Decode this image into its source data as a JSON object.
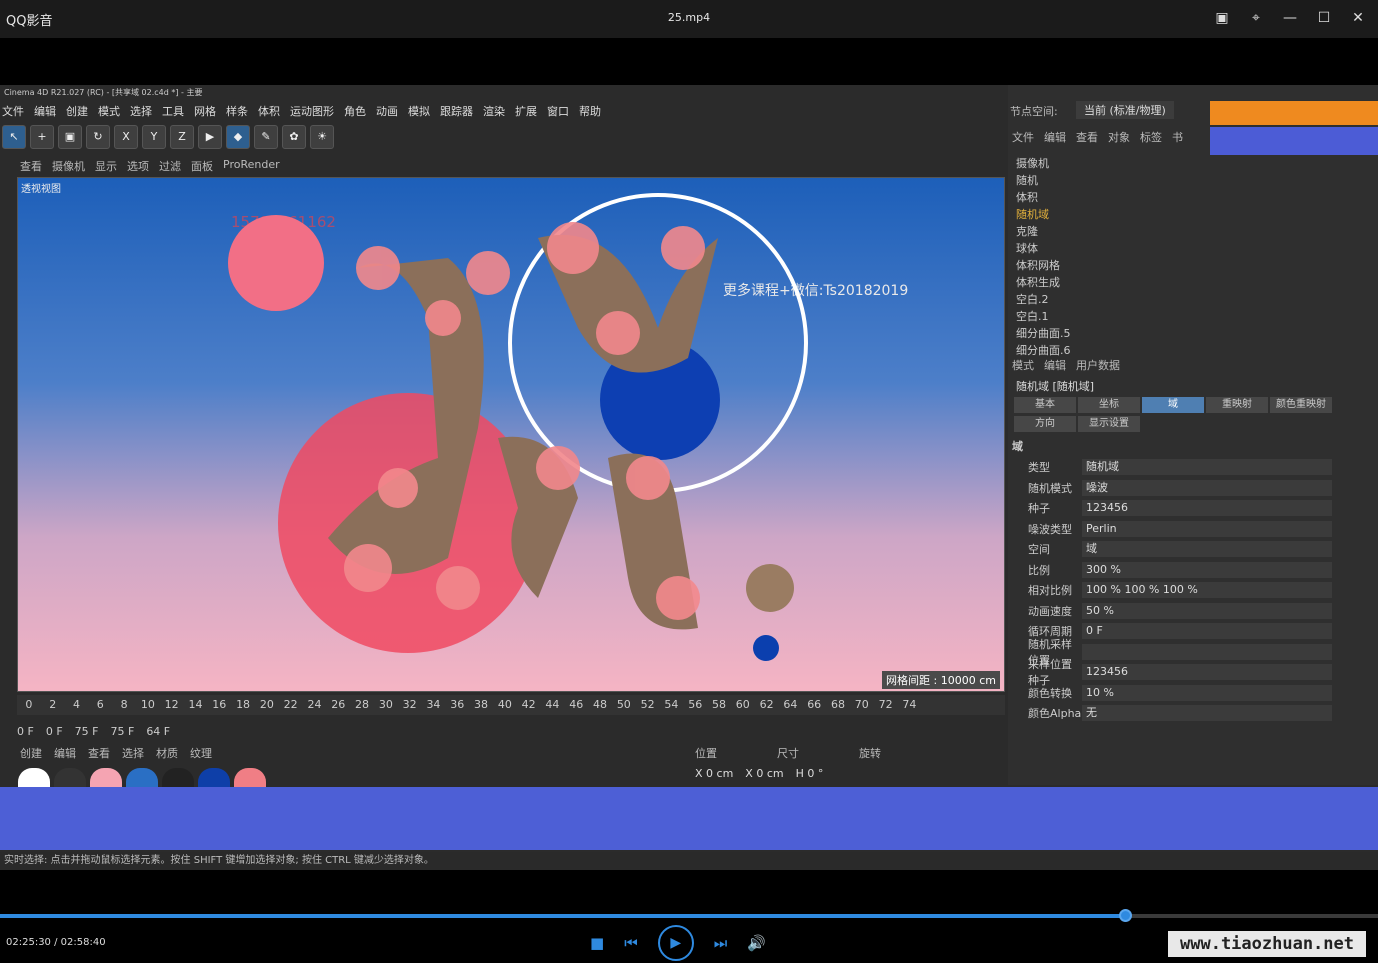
{
  "player": {
    "app_name": "QQ影音",
    "file_name": "25.mp4",
    "current_time": "02:25:30",
    "duration": "02:58:40",
    "progress": 0.813,
    "site": "www.tiaozhuan.net"
  },
  "c4d": {
    "title": "Cinema 4D R21.027 (RC) - [共享域 02.c4d *] - 主要",
    "menu": [
      "文件",
      "编辑",
      "创建",
      "模式",
      "选择",
      "工具",
      "网格",
      "样条",
      "体积",
      "运动图形",
      "角色",
      "动画",
      "模拟",
      "跟踪器",
      "渲染",
      "扩展",
      "窗口",
      "帮助"
    ],
    "view_menu": [
      "查看",
      "摄像机",
      "显示",
      "选项",
      "过滤",
      "面板",
      "ProRender"
    ],
    "viewport_label": "透视视图",
    "watermark": "更多课程+微信:Ts20182019",
    "phone": "15797761162",
    "grid_distance": "网格间距 : 10000 cm",
    "timeline": [
      "0",
      "2",
      "4",
      "6",
      "8",
      "10",
      "12",
      "14",
      "16",
      "18",
      "20",
      "22",
      "24",
      "26",
      "28",
      "30",
      "32",
      "34",
      "36",
      "38",
      "40",
      "42",
      "44",
      "46",
      "48",
      "50",
      "52",
      "54",
      "56",
      "58",
      "60",
      "62",
      "64",
      "66",
      "68",
      "70",
      "72",
      "74"
    ],
    "current_frame": "64 F",
    "start": "0 F",
    "cur": "0 F",
    "end": "75 F",
    "end2": "75 F",
    "mat_menu": [
      "创建",
      "编辑",
      "查看",
      "选择",
      "材质",
      "纹理"
    ],
    "coord_headers": [
      "位置",
      "尺寸",
      "旋转"
    ],
    "coord_x": "X  0 cm",
    "coord_sx": "X  0 cm",
    "coord_h": "H  0 °",
    "status": "实时选择: 点击并拖动鼠标选择元素。按住 SHIFT 键增加选择对象; 按住 CTRL 键减少选择对象。",
    "node_space_label": "节点空间:",
    "node_space_value": "当前 (标准/物理)",
    "obj_menu": [
      "文件",
      "编辑",
      "查看",
      "对象",
      "标签",
      "书"
    ],
    "objects": [
      "摄像机",
      "随机",
      "体积",
      "随机域",
      "克隆",
      "球体",
      "体积网格",
      "体积生成",
      "空白.2",
      "空白.1",
      "细分曲面.5",
      "细分曲面.6"
    ],
    "attr_menu": [
      "模式",
      "编辑",
      "用户数据"
    ],
    "attr_title": "随机域 [随机域]",
    "tabs": [
      "基本",
      "坐标",
      "域",
      "重映射",
      "颜色重映射"
    ],
    "tabs2": [
      "方向",
      "显示设置"
    ],
    "section": "域",
    "props": [
      {
        "label": "类型",
        "value": "随机域"
      },
      {
        "label": "随机模式",
        "value": "噪波"
      },
      {
        "label": "种子",
        "value": "123456"
      },
      {
        "label": "噪波类型",
        "value": "Perlin"
      },
      {
        "label": "空间",
        "value": "域"
      },
      {
        "label": "比例",
        "value": "300 %"
      },
      {
        "label": "相对比例",
        "value": "100 %   100 %   100 %"
      },
      {
        "label": "动画速度",
        "value": "50 %"
      },
      {
        "label": "循环周期",
        "value": "0 F"
      },
      {
        "label": "随机采样位置",
        "value": ""
      },
      {
        "label": "采样位置种子",
        "value": "123456"
      },
      {
        "label": "颜色转换",
        "value": "10 %"
      },
      {
        "label": "颜色Alpha",
        "value": "无"
      }
    ]
  }
}
